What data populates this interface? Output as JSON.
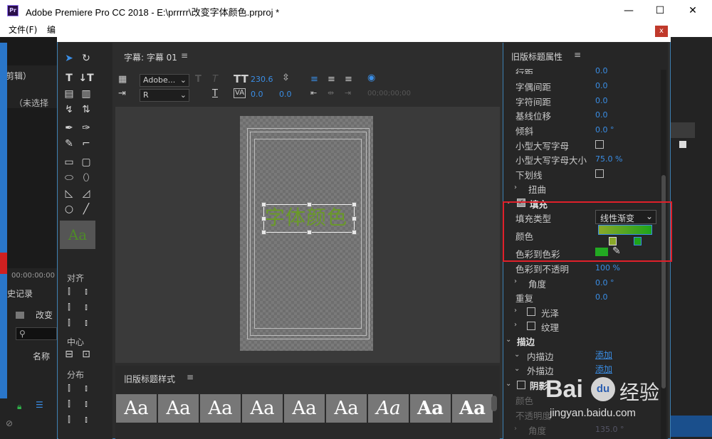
{
  "window": {
    "app_icon": "Pr",
    "title": "Adobe Premiere Pro CC 2018 - E:\\prrrrr\\改变字体颜色.prproj *",
    "minimize": "—",
    "maximize": "☐",
    "close": "✕"
  },
  "menu": {
    "file": "文件(F)",
    "edit": "编"
  },
  "left_panel": {
    "clip_label": "剪辑）",
    "no_selection": "（未选择",
    "timecode": "00:00:00:00",
    "history": "史记录",
    "change": "改变",
    "name_col": "名称"
  },
  "dialog": {
    "close": "x"
  },
  "title_panel": {
    "label": "字幕: 字幕 01",
    "menu": "≡",
    "font_family": "Adobe...",
    "font_style": "R",
    "font_size": "230.6",
    "leading": "0.0",
    "kerning": "0.0",
    "timecode": "00;00;00;00"
  },
  "tools": {
    "align_label": "对齐",
    "center_label": "中心",
    "distribute_label": "分布",
    "thumb": "Aa"
  },
  "canvas": {
    "text": "字体颜色"
  },
  "styles_panel": {
    "label": "旧版标题样式",
    "menu": "≡",
    "samples": [
      "Aa",
      "Aa",
      "Aa",
      "Aa",
      "Aa",
      "Aa",
      "Aa",
      "Aa",
      "Aa"
    ]
  },
  "props_panel": {
    "label": "旧版标题属性",
    "menu": "≡",
    "rows": [
      {
        "label": "行距",
        "value": "0.0"
      },
      {
        "label": "字偶间距",
        "value": "0.0"
      },
      {
        "label": "字符间距",
        "value": "0.0"
      },
      {
        "label": "基线位移",
        "value": "0.0"
      },
      {
        "label": "倾斜",
        "value": "0.0 °"
      },
      {
        "label": "小型大写字母",
        "value": ""
      },
      {
        "label": "小型大写字母大小",
        "value": "75.0 %"
      },
      {
        "label": "下划线",
        "value": ""
      },
      {
        "label": "扭曲",
        "value": ""
      }
    ],
    "fill_label": "填充",
    "fill_type_label": "填充类型",
    "fill_type_value": "线性渐变",
    "color_label": "颜色",
    "color_to_color_label": "色彩到色彩",
    "color_to_opacity_label": "色彩到不透明",
    "color_to_opacity_value": "100 %",
    "angle_label": "角度",
    "angle_value": "0.0 °",
    "repeat_label": "重复",
    "repeat_value": "0.0",
    "sheen_label": "光泽",
    "texture_label": "纹理",
    "stroke_label": "描边",
    "inner_stroke_label": "内描边",
    "outer_stroke_label": "外描边",
    "add_label": "添加",
    "add_label2": "添加",
    "shadow_label": "阴影",
    "shadow_color_label": "颜色",
    "shadow_opacity_label": "不透明度",
    "shadow_angle_label": "角度",
    "shadow_angle_value": "135.0 °"
  },
  "colors": {
    "accent_blue": "#3a8ee6",
    "highlight_red": "#e0202a",
    "gradient_start": "#8aa82a",
    "gradient_end": "#1fa31a",
    "chip_green": "#22aa22"
  },
  "watermark": {
    "brand": "Bai",
    "brand2": "经验",
    "paw": "du",
    "url": "jingyan.baidu.com"
  }
}
